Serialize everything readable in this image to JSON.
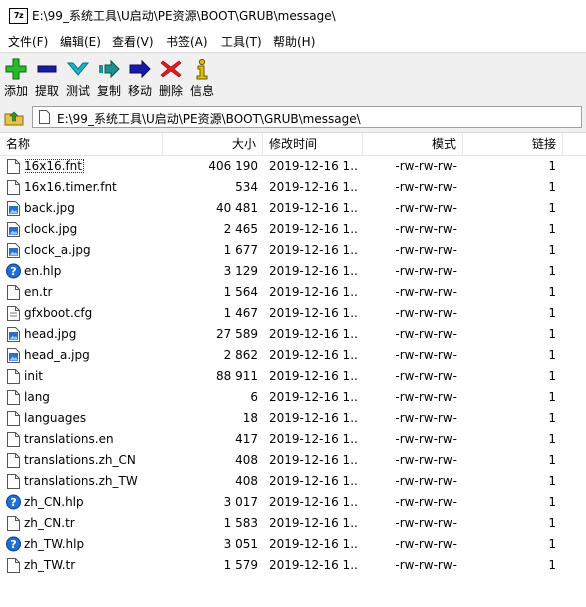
{
  "window": {
    "title": "E:\\99_系统工具\\U启动\\PE资源\\BOOT\\GRUB\\message\\",
    "app_icon_label": "7z"
  },
  "menu": [
    {
      "label": "文件(F)"
    },
    {
      "label": "编辑(E)"
    },
    {
      "label": "查看(V)"
    },
    {
      "label": "书签(A)"
    },
    {
      "label": "工具(T)"
    },
    {
      "label": "帮助(H)"
    }
  ],
  "toolbar": [
    {
      "label": "添加",
      "icon": "add-icon",
      "color": "#2cb82c"
    },
    {
      "label": "提取",
      "icon": "extract-icon",
      "color": "#1a1aa8"
    },
    {
      "label": "测试",
      "icon": "test-icon",
      "color": "#19b5c8"
    },
    {
      "label": "复制",
      "icon": "copy-icon",
      "color": "#1f8f8f"
    },
    {
      "label": "移动",
      "icon": "move-icon",
      "color": "#1a1aa8"
    },
    {
      "label": "删除",
      "icon": "delete-icon",
      "color": "#e02020"
    },
    {
      "label": "信息",
      "icon": "info-icon",
      "color": "#e0c000"
    }
  ],
  "address": {
    "path": "E:\\99_系统工具\\U启动\\PE资源\\BOOT\\GRUB\\message\\"
  },
  "columns": {
    "name": "名称",
    "size": "大小",
    "modified": "修改时间",
    "mode": "模式",
    "links": "链接"
  },
  "files": [
    {
      "name": "16x16.fnt",
      "size": "406 190",
      "modified": "2019-12-16 1...",
      "mode": "-rw-rw-rw-",
      "links": "1",
      "icon": "file-icon"
    },
    {
      "name": "16x16.timer.fnt",
      "size": "534",
      "modified": "2019-12-16 1...",
      "mode": "-rw-rw-rw-",
      "links": "1",
      "icon": "file-icon"
    },
    {
      "name": "back.jpg",
      "size": "40 481",
      "modified": "2019-12-16 1...",
      "mode": "-rw-rw-rw-",
      "links": "1",
      "icon": "image-icon"
    },
    {
      "name": "clock.jpg",
      "size": "2 465",
      "modified": "2019-12-16 1...",
      "mode": "-rw-rw-rw-",
      "links": "1",
      "icon": "image-icon"
    },
    {
      "name": "clock_a.jpg",
      "size": "1 677",
      "modified": "2019-12-16 1...",
      "mode": "-rw-rw-rw-",
      "links": "1",
      "icon": "image-icon"
    },
    {
      "name": "en.hlp",
      "size": "3 129",
      "modified": "2019-12-16 1...",
      "mode": "-rw-rw-rw-",
      "links": "1",
      "icon": "help-icon"
    },
    {
      "name": "en.tr",
      "size": "1 564",
      "modified": "2019-12-16 1...",
      "mode": "-rw-rw-rw-",
      "links": "1",
      "icon": "file-icon"
    },
    {
      "name": "gfxboot.cfg",
      "size": "1 467",
      "modified": "2019-12-16 1...",
      "mode": "-rw-rw-rw-",
      "links": "1",
      "icon": "config-icon"
    },
    {
      "name": "head.jpg",
      "size": "27 589",
      "modified": "2019-12-16 1...",
      "mode": "-rw-rw-rw-",
      "links": "1",
      "icon": "image-icon"
    },
    {
      "name": "head_a.jpg",
      "size": "2 862",
      "modified": "2019-12-16 1...",
      "mode": "-rw-rw-rw-",
      "links": "1",
      "icon": "image-icon"
    },
    {
      "name": "init",
      "size": "88 911",
      "modified": "2019-12-16 1...",
      "mode": "-rw-rw-rw-",
      "links": "1",
      "icon": "file-icon"
    },
    {
      "name": "lang",
      "size": "6",
      "modified": "2019-12-16 1...",
      "mode": "-rw-rw-rw-",
      "links": "1",
      "icon": "file-icon"
    },
    {
      "name": "languages",
      "size": "18",
      "modified": "2019-12-16 1...",
      "mode": "-rw-rw-rw-",
      "links": "1",
      "icon": "file-icon"
    },
    {
      "name": "translations.en",
      "size": "417",
      "modified": "2019-12-16 1...",
      "mode": "-rw-rw-rw-",
      "links": "1",
      "icon": "file-icon"
    },
    {
      "name": "translations.zh_CN",
      "size": "408",
      "modified": "2019-12-16 1...",
      "mode": "-rw-rw-rw-",
      "links": "1",
      "icon": "file-icon"
    },
    {
      "name": "translations.zh_TW",
      "size": "408",
      "modified": "2019-12-16 1...",
      "mode": "-rw-rw-rw-",
      "links": "1",
      "icon": "file-icon"
    },
    {
      "name": "zh_CN.hlp",
      "size": "3 017",
      "modified": "2019-12-16 1...",
      "mode": "-rw-rw-rw-",
      "links": "1",
      "icon": "help-icon"
    },
    {
      "name": "zh_CN.tr",
      "size": "1 583",
      "modified": "2019-12-16 1...",
      "mode": "-rw-rw-rw-",
      "links": "1",
      "icon": "file-icon"
    },
    {
      "name": "zh_TW.hlp",
      "size": "3 051",
      "modified": "2019-12-16 1...",
      "mode": "-rw-rw-rw-",
      "links": "1",
      "icon": "help-icon"
    },
    {
      "name": "zh_TW.tr",
      "size": "1 579",
      "modified": "2019-12-16 1...",
      "mode": "-rw-rw-rw-",
      "links": "1",
      "icon": "file-icon"
    }
  ],
  "selected_index": 0
}
